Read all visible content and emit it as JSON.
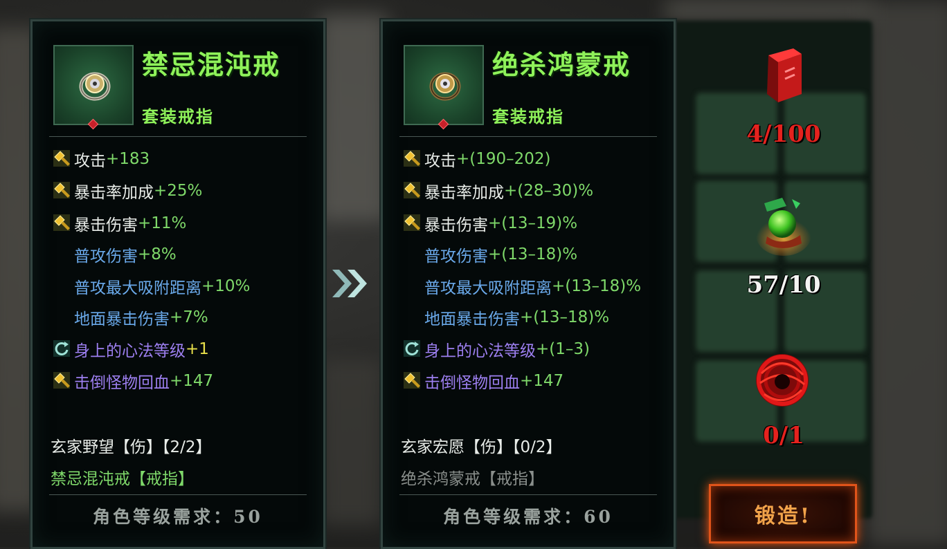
{
  "left_item": {
    "name": "禁忌混沌戒",
    "type": "套装戒指",
    "stats": [
      {
        "icon": "hammer-icon",
        "label": "攻击",
        "value": "+183",
        "label_color": "white",
        "value_color": "green"
      },
      {
        "icon": "hammer-icon",
        "label": "暴击率加成",
        "value": "+25%",
        "label_color": "white",
        "value_color": "green"
      },
      {
        "icon": "hammer-icon",
        "label": "暴击伤害",
        "value": "+11%",
        "label_color": "white",
        "value_color": "green"
      },
      {
        "icon": "none",
        "label": "普攻伤害",
        "value": "+8%",
        "label_color": "blue",
        "value_color": "green"
      },
      {
        "icon": "none",
        "label": "普攻最大吸附距离",
        "value": "+10%",
        "label_color": "blue",
        "value_color": "green"
      },
      {
        "icon": "none",
        "label": "地面暴击伤害",
        "value": "+7%",
        "label_color": "blue",
        "value_color": "green"
      },
      {
        "icon": "refresh-icon",
        "label": "身上的心法等级",
        "value": "+1",
        "label_color": "purple",
        "value_color": "yellow"
      },
      {
        "icon": "hammer-icon",
        "label": "击倒怪物回血",
        "value": "+147",
        "label_color": "purple",
        "value_color": "green"
      }
    ],
    "set_name": "玄家野望【伤】【2/2】",
    "set_piece": "禁忌混沌戒【戒指】",
    "level_requirement": "角色等级需求：50"
  },
  "right_item": {
    "name": "绝杀鸿蒙戒",
    "type": "套装戒指",
    "stats": [
      {
        "icon": "hammer-icon",
        "label": "攻击",
        "value": "+(190–202)",
        "label_color": "white",
        "value_color": "green"
      },
      {
        "icon": "hammer-icon",
        "label": "暴击率加成",
        "value": "+(28–30)%",
        "label_color": "white",
        "value_color": "green"
      },
      {
        "icon": "hammer-icon",
        "label": "暴击伤害",
        "value": "+(13–19)%",
        "label_color": "white",
        "value_color": "green"
      },
      {
        "icon": "none",
        "label": "普攻伤害",
        "value": "+(13–18)%",
        "label_color": "blue",
        "value_color": "green"
      },
      {
        "icon": "none",
        "label": "普攻最大吸附距离",
        "value": "+(13–18)%",
        "label_color": "blue",
        "value_color": "green"
      },
      {
        "icon": "none",
        "label": "地面暴击伤害",
        "value": "+(13–18)%",
        "label_color": "blue",
        "value_color": "green"
      },
      {
        "icon": "refresh-icon",
        "label": "身上的心法等级",
        "value": "+(1–3)",
        "label_color": "purple",
        "value_color": "green"
      },
      {
        "icon": "hammer-icon",
        "label": "击倒怪物回血",
        "value": "+147",
        "label_color": "purple",
        "value_color": "green"
      }
    ],
    "set_name": "玄家宏愿【伤】【0/2】",
    "set_piece": "绝杀鸿蒙戒【戒指】",
    "level_requirement": "角色等级需求：60"
  },
  "materials": [
    {
      "icon": "red-book-icon",
      "count": "4/100",
      "color": "#e5221e"
    },
    {
      "icon": "green-orb-icon",
      "count": "57/10",
      "color": "#f4f4f2"
    },
    {
      "icon": "red-thread-icon",
      "count": "0/1",
      "color": "#e5221e"
    }
  ],
  "forge_button": "锻造!"
}
